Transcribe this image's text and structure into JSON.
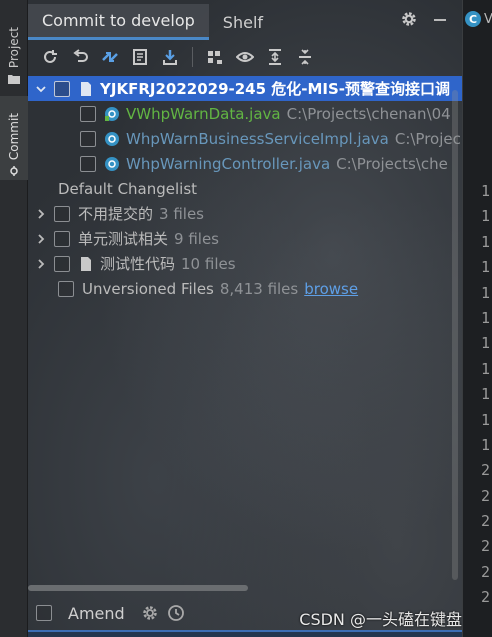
{
  "sidebar": {
    "tabs": [
      {
        "label": "Project"
      },
      {
        "label": "Commit"
      }
    ]
  },
  "tabs": [
    {
      "label": "Commit to develop"
    },
    {
      "label": "Shelf"
    }
  ],
  "toolbar": {
    "icons": [
      "refresh-icon",
      "rollback-icon",
      "diff-icon",
      "shelve-icon",
      "download-icon",
      "group-by-icon",
      "view-options-icon",
      "expand-all-icon",
      "collapse-all-icon"
    ]
  },
  "changelist": {
    "name": "YJKFRJ2022029-245 危化-MIS-预警查询接口调",
    "files": [
      {
        "name": "VWhpWarnData.java",
        "path": "C:\\Projects\\chenan\\04",
        "color": "#62b543"
      },
      {
        "name": "WhpWarnBusinessServiceImpl.java",
        "path": "C:\\Projec",
        "color": "#6897bb"
      },
      {
        "name": "WhpWarningController.java",
        "path": "C:\\Projects\\che",
        "color": "#6897bb"
      }
    ]
  },
  "default_changelist": {
    "label": "Default Changelist"
  },
  "groups": [
    {
      "label": "不用提交的",
      "count": "3 files"
    },
    {
      "label": "单元测试相关",
      "count": "9 files"
    },
    {
      "label": "测试性代码",
      "count": "10 files"
    }
  ],
  "unversioned": {
    "label": "Unversioned Files",
    "count": "8,413 files",
    "link": "browse"
  },
  "bottom": {
    "amend_label": "Amend"
  },
  "right_panel": {
    "tab_letter": "C",
    "tab_label": "V",
    "line_numbers": [
      "1",
      "1",
      "1",
      "1",
      "1",
      "1",
      "1",
      "1",
      "1",
      "1",
      "1",
      "2",
      "2",
      "2",
      "2",
      "2",
      "2"
    ]
  },
  "watermark": "CSDN @一头磕在键盘上"
}
